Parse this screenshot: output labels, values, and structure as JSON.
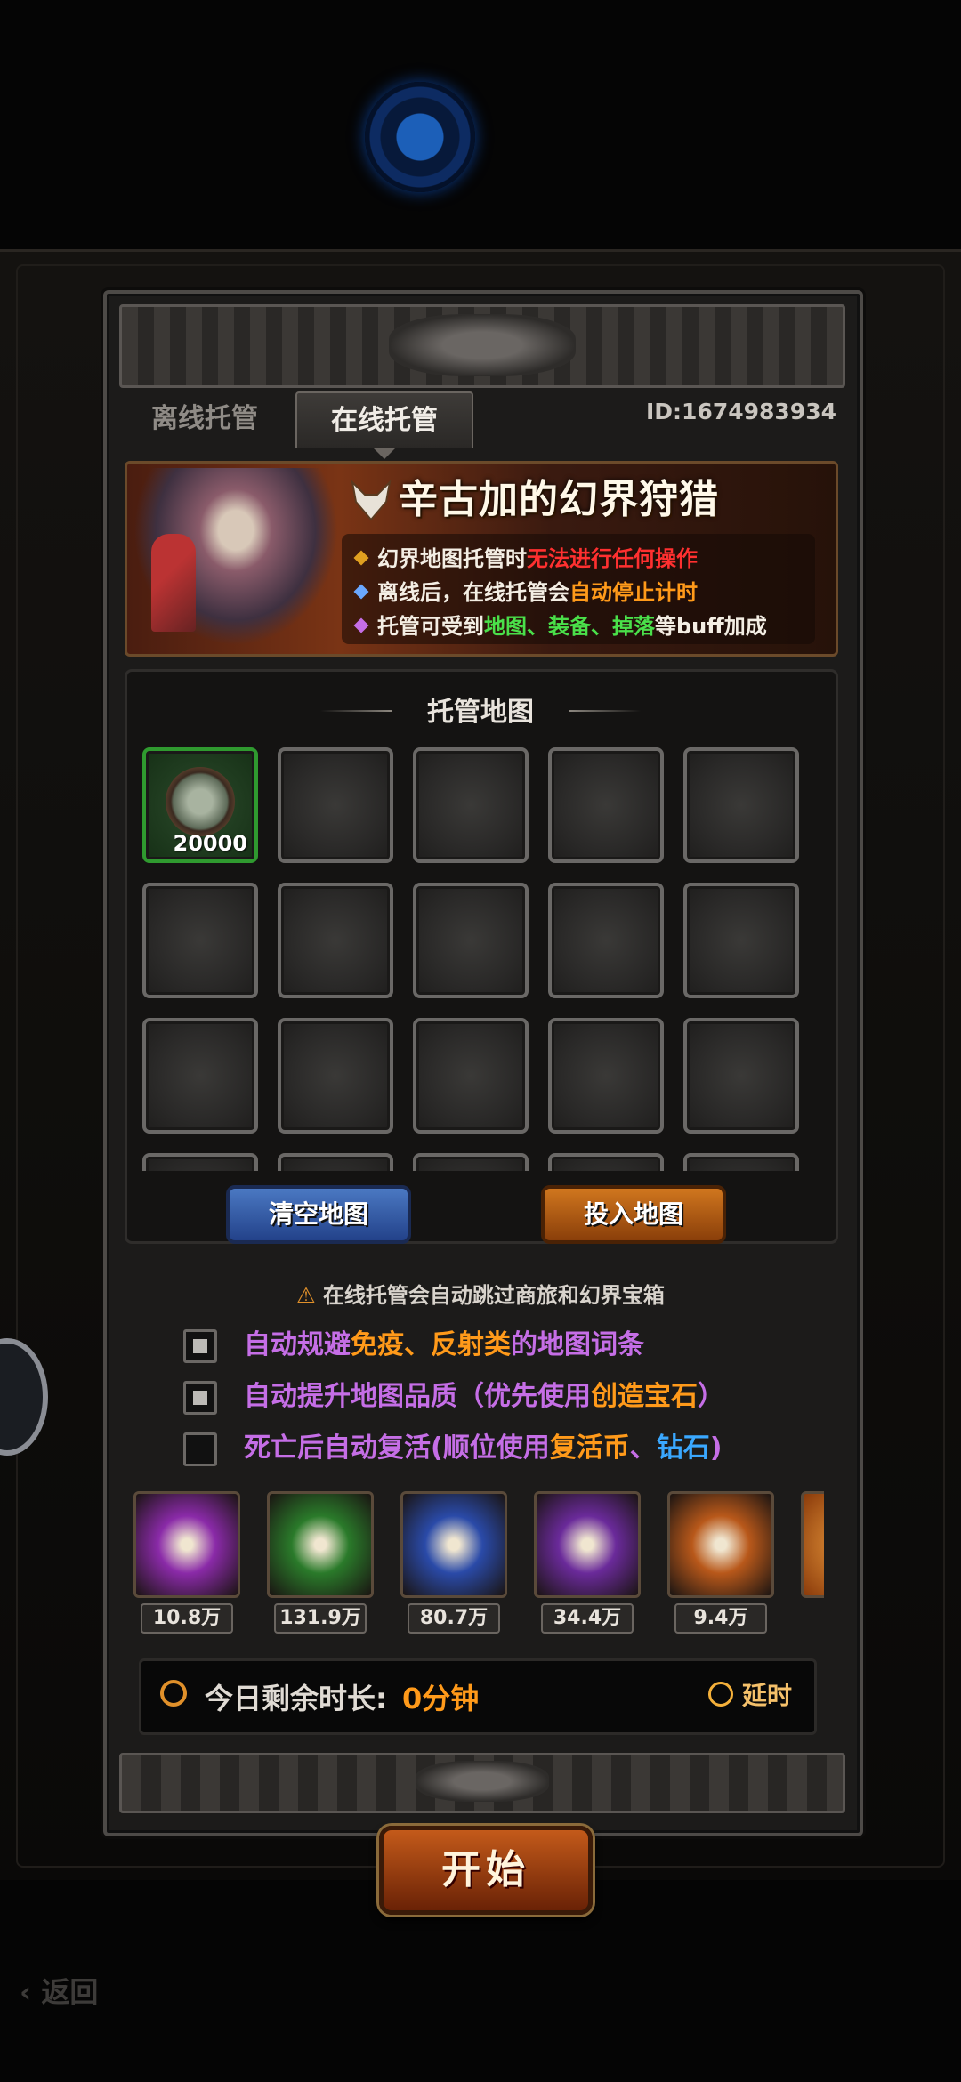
{
  "tabs": {
    "offline": "离线托管",
    "online": "在线托管"
  },
  "user_id": "ID:1674983934",
  "banner": {
    "title": "辛古加的幻界狩猎",
    "notes": [
      {
        "bullet_color": "#e0a020",
        "parts": [
          {
            "text": "幻界地图托管时",
            "tone": ""
          },
          {
            "text": "无法进行任何操作",
            "tone": "red"
          }
        ]
      },
      {
        "bullet_color": "#6aa8ff",
        "parts": [
          {
            "text": "离线后，在线托管会",
            "tone": ""
          },
          {
            "text": "自动停止计时",
            "tone": "orange"
          }
        ]
      },
      {
        "bullet_color": "#c56ee6",
        "parts": [
          {
            "text": "托管可受到",
            "tone": ""
          },
          {
            "text": "地图、装备、掉落",
            "tone": "green"
          },
          {
            "text": "等buff加成",
            "tone": ""
          }
        ]
      }
    ]
  },
  "map": {
    "title": "托管地图",
    "first_slot_count": "20000",
    "clear_label": "清空地图",
    "insert_label": "投入地图"
  },
  "options": {
    "skip_note": "在线托管会自动跳过商旅和幻界宝箱",
    "items": [
      {
        "checked": true,
        "parts": [
          {
            "text": "自动规避",
            "tone": "purple"
          },
          {
            "text": "免疫、反射类",
            "tone": "orange"
          },
          {
            "text": "的地图词条",
            "tone": "purple"
          }
        ]
      },
      {
        "checked": true,
        "parts": [
          {
            "text": "自动提升地图品质（优先使用",
            "tone": "purple"
          },
          {
            "text": "创造宝石",
            "tone": "orange"
          },
          {
            "text": "）",
            "tone": "purple"
          }
        ]
      },
      {
        "checked": false,
        "parts": [
          {
            "text": "死亡后自动复活(顺位使用",
            "tone": "purple"
          },
          {
            "text": "复活币",
            "tone": "orange"
          },
          {
            "text": "、",
            "tone": "purple"
          },
          {
            "text": "钻石",
            "tone": "cyan"
          },
          {
            "text": ")",
            "tone": "purple"
          }
        ]
      }
    ]
  },
  "resources": [
    {
      "icon": "purple-energy-orb-icon",
      "count": "10.8万",
      "color": "#8a2aa8"
    },
    {
      "icon": "green-crystal-icon",
      "count": "131.9万",
      "color": "#2a7a2a"
    },
    {
      "icon": "blue-crystal-icon",
      "count": "80.7万",
      "color": "#2a4aa8"
    },
    {
      "icon": "purple-gem-icon",
      "count": "34.4万",
      "color": "#6a2a9a"
    },
    {
      "icon": "orange-cube-icon",
      "count": "9.4万",
      "color": "#b8581a"
    }
  ],
  "timer": {
    "label": "今日剩余时长:",
    "value": "0分钟",
    "extend_label": "延时"
  },
  "start_label": "开始",
  "back_label": "返回",
  "colors": {
    "red": "#ff3030",
    "orange": "#ff9a1a",
    "green": "#4ae04a",
    "purple": "#c56ee6",
    "cyan": "#3aa8ff"
  }
}
